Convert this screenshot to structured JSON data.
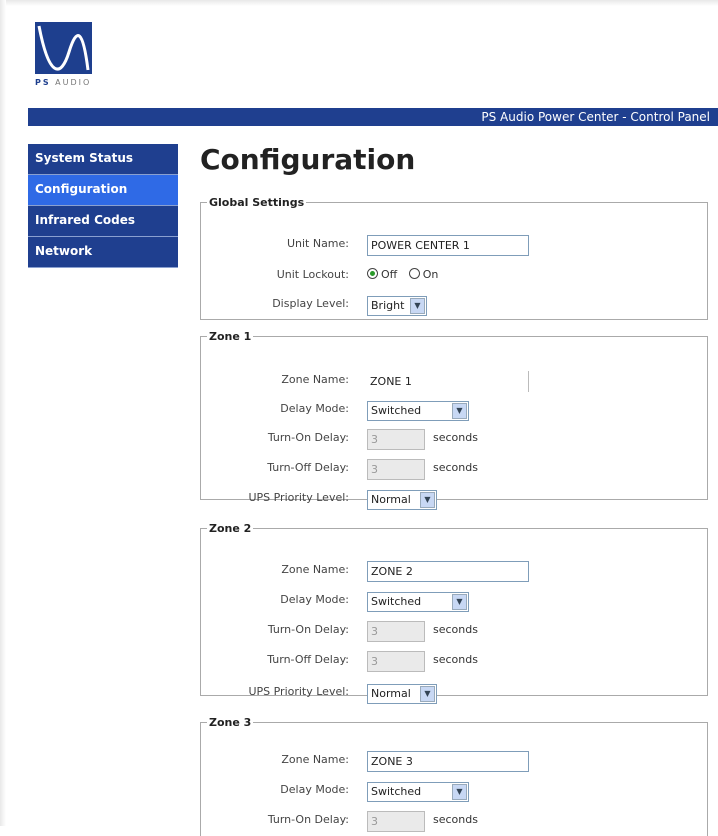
{
  "logo": {
    "text_brand": "PS",
    "text_rest": " AUDIO"
  },
  "banner": {
    "title": "PS Audio Power Center - Control Panel"
  },
  "nav": {
    "items": [
      {
        "label": "System Status"
      },
      {
        "label": "Configuration"
      },
      {
        "label": "Infrared Codes"
      },
      {
        "label": "Network"
      }
    ]
  },
  "page": {
    "title": "Configuration"
  },
  "units": {
    "seconds": "seconds"
  },
  "global": {
    "legend": "Global Settings",
    "unit_name_label": "Unit Name:",
    "unit_name_value": "POWER CENTER 1",
    "lockout_label": "Unit Lockout:",
    "lockout_off": "Off",
    "lockout_on": "On",
    "display_label": "Display Level:",
    "display_value": "Bright"
  },
  "zone1": {
    "legend": "Zone 1",
    "name_label": "Zone Name:",
    "name_value": "ZONE 1",
    "delay_mode_label": "Delay Mode:",
    "delay_mode_value": "Switched",
    "on_delay_label": "Turn-On Delay:",
    "on_delay_value": "3",
    "off_delay_label": "Turn-Off Delay:",
    "off_delay_value": "3",
    "ups_label": "UPS Priority Level:",
    "ups_value": "Normal"
  },
  "zone2": {
    "legend": "Zone 2",
    "name_label": "Zone Name:",
    "name_value": "ZONE 2",
    "delay_mode_label": "Delay Mode:",
    "delay_mode_value": "Switched",
    "on_delay_label": "Turn-On Delay:",
    "on_delay_value": "3",
    "off_delay_label": "Turn-Off Delay:",
    "off_delay_value": "3",
    "ups_label": "UPS Priority Level:",
    "ups_value": "Normal"
  },
  "zone3": {
    "legend": "Zone 3",
    "name_label": "Zone Name:",
    "name_value": "ZONE 3",
    "delay_mode_label": "Delay Mode:",
    "delay_mode_value": "Switched",
    "on_delay_label": "Turn-On Delay:",
    "on_delay_value": "3"
  },
  "colors": {
    "nav_bg": "#1f3f8f",
    "nav_active": "#2f6ae6",
    "brand": "#1e3f8e"
  }
}
